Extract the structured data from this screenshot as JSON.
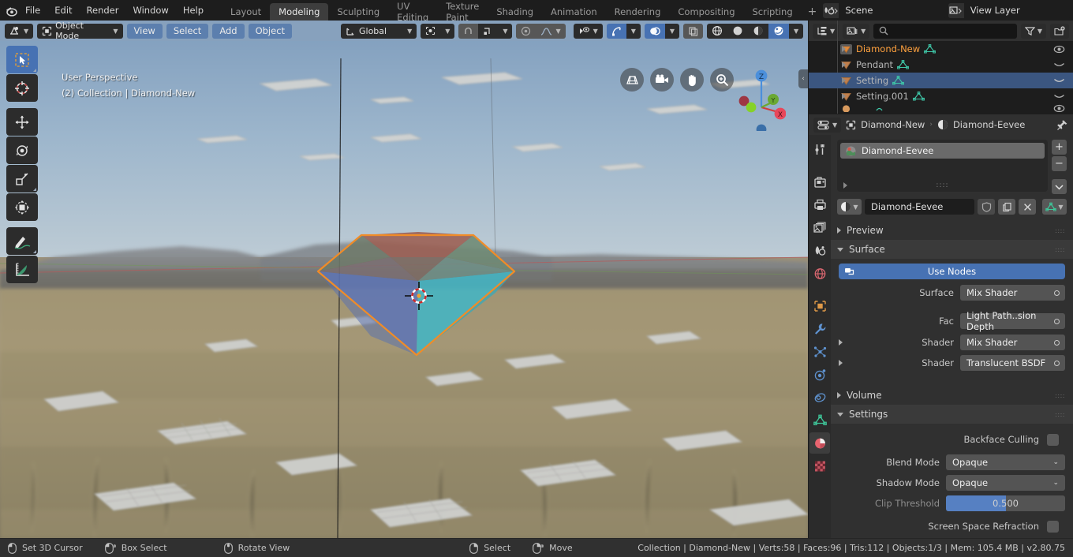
{
  "topbar": {
    "logo_icon": "blender-logo-icon",
    "menus": [
      "File",
      "Edit",
      "Render",
      "Window",
      "Help"
    ],
    "workspaces": [
      {
        "label": "Layout",
        "active": false
      },
      {
        "label": "Modeling",
        "active": true
      },
      {
        "label": "Sculpting",
        "active": false
      },
      {
        "label": "UV Editing",
        "active": false
      },
      {
        "label": "Texture Paint",
        "active": false
      },
      {
        "label": "Shading",
        "active": false
      },
      {
        "label": "Animation",
        "active": false
      },
      {
        "label": "Rendering",
        "active": false
      },
      {
        "label": "Compositing",
        "active": false
      },
      {
        "label": "Scripting",
        "active": false
      }
    ],
    "add_workspace_label": "+",
    "scene": {
      "icon": "scene-icon",
      "name": "Scene",
      "new_icon": "new-copy-icon",
      "unlink_icon": "x-icon"
    },
    "view_layer": {
      "icon": "view-layer-icon",
      "name": "View Layer",
      "new_icon": "new-copy-icon",
      "unlink_icon": "x-icon"
    }
  },
  "viewport": {
    "header": {
      "editor_type_icon": "editor-type-3dview-icon",
      "mode": "Object Mode",
      "mode_icon": "object-mode-icon",
      "menus": [
        "View",
        "Select",
        "Add",
        "Object"
      ],
      "transform_orientation": "Global",
      "transform_orientation_icon": "orientation-icon",
      "pivot_icon": "pivot-point-icon",
      "snap_magnet_icon": "snap-magnet-icon",
      "snap_target_icon": "snap-target-icon",
      "proportional_icon": "proportional-edit-icon",
      "proportional_falloff_icon": "falloff-curve-icon",
      "visibility_icon": "show-hide-icon",
      "gizmo_icon": "gizmo-icon",
      "overlay_icon": "overlays-icon",
      "xray_icon": "xray-toggle-icon",
      "shading_modes": [
        "wireframe-icon",
        "solid-icon",
        "material-preview-icon",
        "rendered-icon"
      ],
      "shading_active_index": 3
    },
    "overlay_text_line1": "User Perspective",
    "overlay_text_line2": "(2) Collection | Diamond-New",
    "nav_buttons": [
      "zoom-camera-grid-icon",
      "camera-view-icon",
      "pan-hand-icon",
      "zoom-magnifier-icon"
    ],
    "axis_gizmo": {
      "z_label": "Z",
      "x_label": "X",
      "y_label": "Y"
    },
    "sidepanel_toggle_icon": "chevron-left-icon",
    "toolbar": [
      {
        "name": "select-box-tool",
        "icon": "cursor-arrow-icon",
        "active": true
      },
      {
        "name": "cursor-tool",
        "icon": "3d-cursor-icon",
        "active": false
      },
      {
        "name": "move-tool",
        "icon": "move-arrows-icon",
        "active": false
      },
      {
        "name": "rotate-tool",
        "icon": "rotate-icon",
        "active": false
      },
      {
        "name": "scale-tool",
        "icon": "scale-icon",
        "active": false
      },
      {
        "name": "transform-tool",
        "icon": "transform-icon",
        "active": false
      },
      {
        "name": "annotate-tool",
        "icon": "pencil-annotate-icon",
        "active": false
      },
      {
        "name": "measure-tool",
        "icon": "ruler-measure-icon",
        "active": false
      }
    ]
  },
  "outliner": {
    "header": {
      "display_mode_icon": "outliner-display-mode-icon",
      "filter_id_icon": "filter-id-type-icon",
      "search_icon": "search-icon",
      "search_placeholder": "",
      "search_value": "",
      "filter_icon": "funnel-filter-icon",
      "new_collection_icon": "new-collection-icon"
    },
    "rows": [
      {
        "name": "Diamond-New",
        "icon": "mesh-object-icon",
        "data_icon": "mesh-data-icon",
        "state": "active",
        "visibility_icon": "eye-open-icon"
      },
      {
        "name": "Pendant",
        "icon": "mesh-object-icon",
        "data_icon": "mesh-data-icon",
        "state": "normal",
        "visibility_icon": "eye-closed-icon"
      },
      {
        "name": "Setting",
        "icon": "mesh-object-icon",
        "data_icon": "mesh-data-icon",
        "state": "selected",
        "visibility_icon": "eye-closed-icon"
      },
      {
        "name": "Setting.001",
        "icon": "mesh-object-icon",
        "data_icon": "mesh-data-icon",
        "state": "normal",
        "visibility_icon": "eye-closed-icon"
      }
    ]
  },
  "properties": {
    "header": {
      "editor_type_icon": "editor-type-properties-icon",
      "breadcrumb_object_icon": "object-icon",
      "breadcrumb_object": "Diamond-New",
      "breadcrumb_material_icon": "material-icon",
      "breadcrumb_material": "Diamond-Eevee",
      "pin_icon": "pin-icon"
    },
    "tabs": [
      {
        "name": "tool",
        "icon": "tool-icon",
        "active": false
      },
      {
        "name": "render",
        "icon": "render-camera-icon",
        "active": false
      },
      {
        "name": "output",
        "icon": "output-printer-icon",
        "active": false
      },
      {
        "name": "view-layer",
        "icon": "view-layer-images-icon",
        "active": false
      },
      {
        "name": "scene",
        "icon": "scene-cone-icon",
        "active": false
      },
      {
        "name": "world",
        "icon": "world-globe-icon",
        "active": false
      },
      {
        "name": "object",
        "icon": "object-square-icon",
        "active": false
      },
      {
        "name": "modifiers",
        "icon": "wrench-icon",
        "active": false
      },
      {
        "name": "particles",
        "icon": "particles-icon",
        "active": false
      },
      {
        "name": "physics",
        "icon": "physics-orbit-icon",
        "active": false
      },
      {
        "name": "constraints",
        "icon": "constraints-icon",
        "active": false
      },
      {
        "name": "data",
        "icon": "mesh-data-green-icon",
        "active": false
      },
      {
        "name": "material",
        "icon": "material-sphere-icon",
        "active": true
      },
      {
        "name": "texture",
        "icon": "texture-checker-icon",
        "active": false
      }
    ],
    "material_slots": [
      {
        "name": "Diamond-Eevee",
        "icon": "material-preview-ball-icon",
        "selected": true
      }
    ],
    "slot_buttons": {
      "add": "+",
      "remove": "−",
      "specials": "chevron-down-icon"
    },
    "material_id": {
      "browse_icon": "browse-material-icon",
      "name": "Diamond-Eevee",
      "fake_user_icon": "shield-fake-user-icon",
      "new_icon": "new-copy-icon",
      "unlink_icon": "x-icon",
      "node_icon": "node-tree-icon"
    },
    "panels": {
      "preview": {
        "label": "Preview",
        "open": false
      },
      "surface": {
        "label": "Surface",
        "open": true
      },
      "volume": {
        "label": "Volume",
        "open": false
      },
      "settings": {
        "label": "Settings",
        "open": true
      }
    },
    "use_nodes": {
      "label": "Use Nodes",
      "icon": "nodetree-icon"
    },
    "surface_rows": [
      {
        "label": "Surface",
        "value": "Mix Shader",
        "has_expand": false,
        "socket": true
      },
      {
        "label": "Fac",
        "value": "Light Path..sion Depth",
        "has_expand": false,
        "socket": true
      },
      {
        "label": "Shader",
        "value": "Mix Shader",
        "has_expand": true,
        "socket": true
      },
      {
        "label": "Shader",
        "value": "Translucent BSDF",
        "has_expand": true,
        "socket": true
      }
    ],
    "settings_rows": {
      "backface_culling": {
        "label": "Backface Culling",
        "checked": false
      },
      "blend_mode": {
        "label": "Blend Mode",
        "value": "Opaque"
      },
      "shadow_mode": {
        "label": "Shadow Mode",
        "value": "Opaque"
      },
      "clip_threshold": {
        "label": "Clip Threshold",
        "value": "0.500",
        "fill_percent": 50,
        "enabled": false
      },
      "screen_space_refraction": {
        "label": "Screen Space Refraction",
        "checked": false
      }
    }
  },
  "statusbar": {
    "keymap": [
      {
        "icon": "mouse-left-icon",
        "label": "Set 3D Cursor"
      },
      {
        "icon": "mouse-left-drag-icon",
        "label": "Box Select"
      },
      {
        "icon": "mouse-middle-icon",
        "label": "Rotate View"
      },
      {
        "icon": "mouse-right-icon",
        "label": "Select"
      },
      {
        "icon": "mouse-right-drag-icon",
        "label": "Move"
      }
    ],
    "stats": "Collection | Diamond-New | Verts:58 | Faces:96 | Tris:112 | Objects:1/3 | Mem: 105.4 MB | v2.80.75"
  },
  "colors": {
    "accent_blue": "#4772b3",
    "active_orange": "#ffa13e",
    "selected_row": "#3b5680",
    "panel_bg": "#303030",
    "viewport_header": "#87a1bd"
  }
}
